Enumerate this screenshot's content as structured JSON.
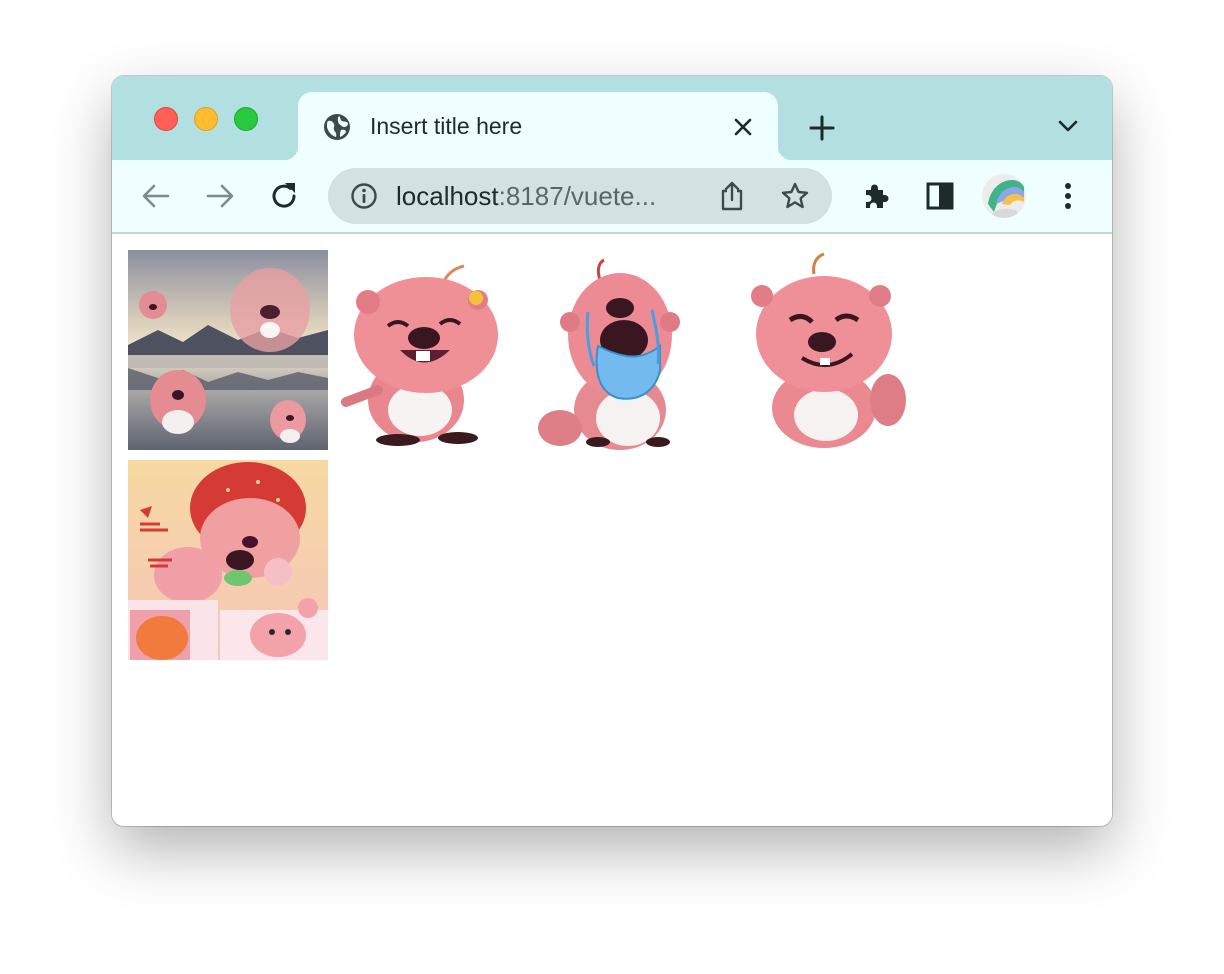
{
  "window": {
    "traffic_lights": {
      "close": "#fe5f57",
      "minimize": "#febc2e",
      "zoom": "#28c840"
    }
  },
  "tab": {
    "title": "Insert title here",
    "favicon": "globe-icon",
    "close_icon": "close-icon"
  },
  "tabstrip": {
    "new_tab_icon": "plus-icon",
    "tab_search_icon": "chevron-down-icon",
    "background": "#b2dfdf"
  },
  "toolbar": {
    "back_icon": "arrow-left-icon",
    "forward_icon": "arrow-right-icon",
    "reload_icon": "reload-icon",
    "background": "#effefe"
  },
  "omnibox": {
    "info_icon": "info-icon",
    "url_host": "localhost",
    "url_rest": ":8187/vuete...",
    "share_icon": "share-icon",
    "bookmark_icon": "star-icon"
  },
  "extensions": {
    "puzzle_icon": "puzzle-icon",
    "side_panel_icon": "side-panel-icon",
    "menu_icon": "kebab-menu-icon"
  },
  "images": [
    {
      "name": "loopy-landscape-collage"
    },
    {
      "name": "loopy-laughing"
    },
    {
      "name": "loopy-crying"
    },
    {
      "name": "loopy-smirking"
    },
    {
      "name": "loopy-strawberry-ad"
    }
  ]
}
